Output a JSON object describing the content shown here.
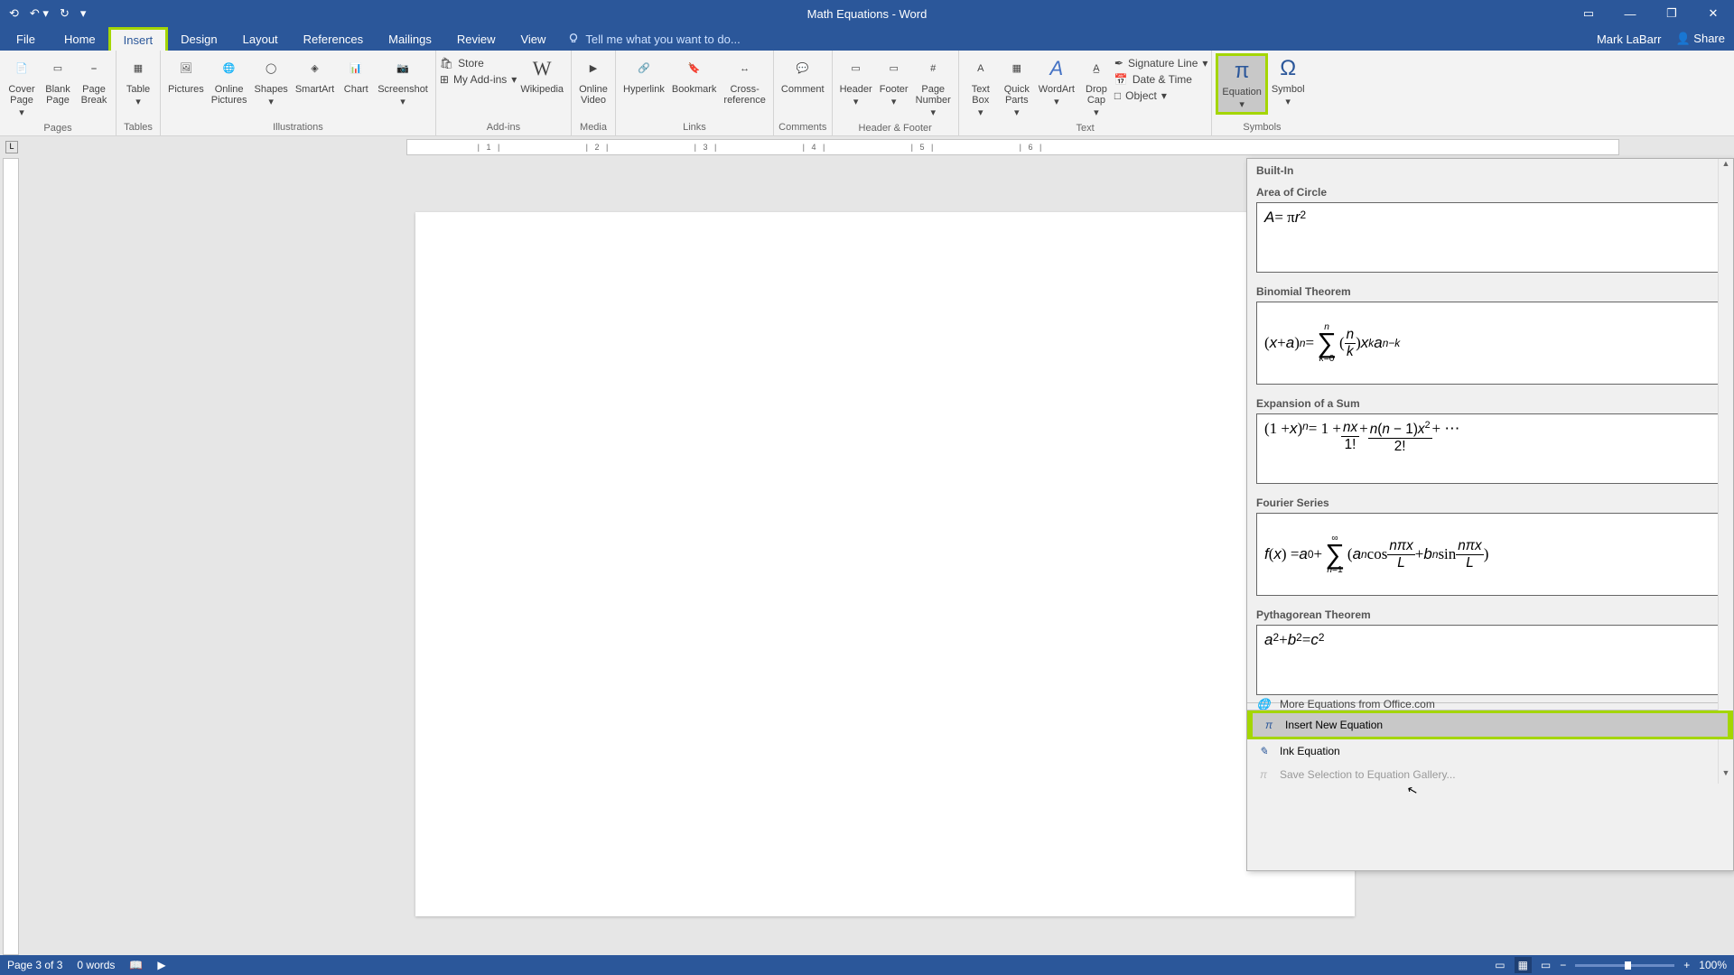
{
  "titlebar": {
    "doc_title": "Math Equations - Word"
  },
  "tabs": {
    "file": "File",
    "home": "Home",
    "insert": "Insert",
    "design": "Design",
    "layout": "Layout",
    "references": "References",
    "mailings": "Mailings",
    "review": "Review",
    "view": "View",
    "tellme": "Tell me what you want to do...",
    "user": "Mark LaBarr",
    "share": "Share"
  },
  "ribbon": {
    "pages": {
      "cover": "Cover\nPage",
      "blank": "Blank\nPage",
      "break": "Page\nBreak",
      "label": "Pages"
    },
    "tables": {
      "table": "Table",
      "label": "Tables"
    },
    "illus": {
      "pictures": "Pictures",
      "online": "Online\nPictures",
      "shapes": "Shapes",
      "smartart": "SmartArt",
      "chart": "Chart",
      "screenshot": "Screenshot",
      "label": "Illustrations"
    },
    "addins": {
      "store": "Store",
      "myaddins": "My Add-ins",
      "wikipedia": "Wikipedia",
      "label": "Add-ins"
    },
    "media": {
      "video": "Online\nVideo",
      "label": "Media"
    },
    "links": {
      "hyperlink": "Hyperlink",
      "bookmark": "Bookmark",
      "crossref": "Cross-\nreference",
      "label": "Links"
    },
    "comments": {
      "comment": "Comment",
      "label": "Comments"
    },
    "hf": {
      "header": "Header",
      "footer": "Footer",
      "pagenum": "Page\nNumber",
      "label": "Header & Footer"
    },
    "text": {
      "textbox": "Text\nBox",
      "quickparts": "Quick\nParts",
      "wordart": "WordArt",
      "dropcap": "Drop\nCap",
      "sig": "Signature Line",
      "date": "Date & Time",
      "object": "Object",
      "label": "Text"
    },
    "symbols": {
      "equation": "Equation",
      "symbol": "Symbol",
      "label": "Symbols"
    }
  },
  "equation_dropdown": {
    "builtin": "Built-In",
    "items": [
      {
        "name": "Area of Circle",
        "formula_html": "<i>A</i> = π<i>r</i><sup>2</sup>"
      },
      {
        "name": "Binomial Theorem",
        "formula_html": "(<i>x</i> + <i>a</i>)<sup><i>n</i></sup> = <span class='sigma'><span class='top'><i>n</i></span><span class='sym'>∑</span><span class='bot'><i>k</i>=0</span></span> (<span class='frac'><span class='num'><i>n</i></span><span class='den'><i>k</i></span></span>) <i>x</i><sup><i>k</i></sup><i>a</i><sup><i>n−k</i></sup>"
      },
      {
        "name": "Expansion of a Sum",
        "formula_html": "(1 + <i>x</i>)<sup><i>n</i></sup> = 1 + <span class='frac'><span class='num'><i>nx</i></span><span class='den'>1!</span></span> + <span class='frac'><span class='num'><i>n</i>(<i>n</i> − 1)<i>x</i><sup>2</sup></span><span class='den'>2!</span></span> + ⋯"
      },
      {
        "name": "Fourier Series",
        "formula_html": "<i>f</i>(<i>x</i>) = <i>a</i><sub>0</sub> + <span class='sigma'><span class='top'>∞</span><span class='sym'>∑</span><span class='bot'><i>n</i>=1</span></span> (<i>a</i><sub><i>n</i></sub> cos <span class='frac'><span class='num'><i>nπx</i></span><span class='den'><i>L</i></span></span> + <i>b</i><sub><i>n</i></sub> sin <span class='frac'><span class='num'><i>nπx</i></span><span class='den'><i>L</i></span></span>)"
      },
      {
        "name": "Pythagorean Theorem",
        "formula_html": "<i>a</i><sup>2</sup> + <i>b</i><sup>2</sup> = <i>c</i><sup>2</sup>"
      }
    ],
    "more": "More Equations from Office.com",
    "insert_new": "Insert New Equation",
    "ink": "Ink Equation",
    "save_sel": "Save Selection to Equation Gallery..."
  },
  "status": {
    "page": "Page 3 of 3",
    "words": "0 words",
    "zoom": "100%"
  },
  "ruler": {
    "marks": [
      "1",
      "2",
      "3",
      "4",
      "5",
      "6"
    ]
  }
}
